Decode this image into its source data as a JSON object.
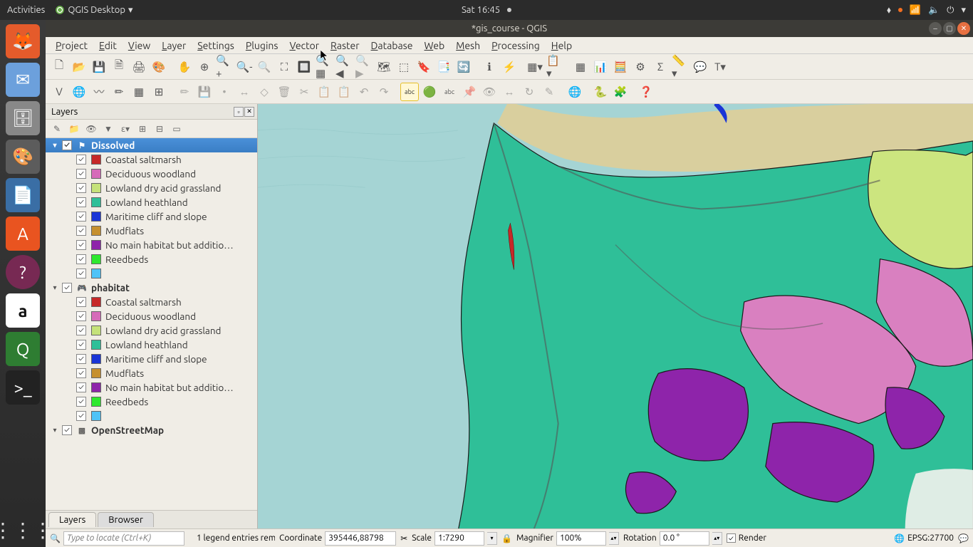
{
  "sysbar": {
    "activities": "Activities",
    "app": "QGIS Desktop",
    "time": "Sat 16:45"
  },
  "window": {
    "title": "*gis_course - QGIS"
  },
  "menubar": [
    "Project",
    "Edit",
    "View",
    "Layer",
    "Settings",
    "Plugins",
    "Vector",
    "Raster",
    "Database",
    "Web",
    "Mesh",
    "Processing",
    "Help"
  ],
  "panel": {
    "title": "Layers",
    "groups": [
      {
        "name": "Dissolved",
        "selected": true,
        "icon": "flag",
        "items": [
          {
            "label": "Coastal saltmarsh",
            "color": "#c62828"
          },
          {
            "label": "Deciduous woodland",
            "color": "#d66bb9"
          },
          {
            "label": "Lowland dry acid grassland",
            "color": "#c5e27a"
          },
          {
            "label": "Lowland heathland",
            "color": "#2fbf98"
          },
          {
            "label": "Maritime cliff and slope",
            "color": "#1a35d6"
          },
          {
            "label": "Mudflats",
            "color": "#c6902e"
          },
          {
            "label": "No main habitat but additio…",
            "color": "#8e24aa"
          },
          {
            "label": "Reedbeds",
            "color": "#2ee82e"
          },
          {
            "label": "",
            "color": "#4fc3f7"
          }
        ]
      },
      {
        "name": "phabitat",
        "selected": false,
        "icon": "controller",
        "items": [
          {
            "label": "Coastal saltmarsh",
            "color": "#c62828"
          },
          {
            "label": "Deciduous woodland",
            "color": "#d66bb9"
          },
          {
            "label": "Lowland dry acid grassland",
            "color": "#c5e27a"
          },
          {
            "label": "Lowland heathland",
            "color": "#2fbf98"
          },
          {
            "label": "Maritime cliff and slope",
            "color": "#1a35d6"
          },
          {
            "label": "Mudflats",
            "color": "#c6902e"
          },
          {
            "label": "No main habitat but additio…",
            "color": "#8e24aa"
          },
          {
            "label": "Reedbeds",
            "color": "#2ee82e"
          },
          {
            "label": "",
            "color": "#4fc3f7"
          }
        ]
      },
      {
        "name": "OpenStreetMap",
        "selected": false,
        "icon": "raster",
        "items": []
      }
    ]
  },
  "bottom_tabs": [
    "Layers",
    "Browser"
  ],
  "status": {
    "locate_placeholder": "Type to locate (Ctrl+K)",
    "legend": "1 legend entries rem",
    "coord_label": "Coordinate",
    "coord": "395446,88798",
    "scale_label": "Scale",
    "scale": "1:7290",
    "mag_label": "Magnifier",
    "mag": "100%",
    "rot_label": "Rotation",
    "rot": "0.0 °",
    "render": "Render",
    "crs": "EPSG:27700"
  },
  "colors": {
    "water": "#a5d4d4",
    "heath": "#2fbf98",
    "grass": "#cce57f",
    "woodland": "#d980c0",
    "purple": "#8e24aa",
    "sand": "#d9cf9e",
    "red": "#c62828",
    "blue": "#1a35d6"
  }
}
